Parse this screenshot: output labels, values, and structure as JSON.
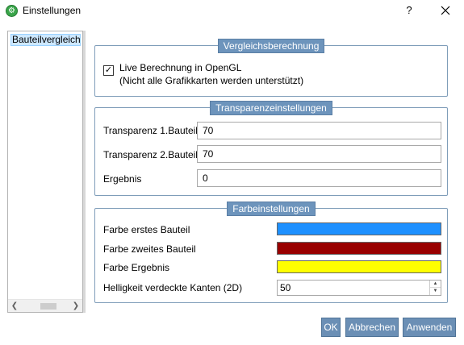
{
  "window": {
    "title": "Einstellungen",
    "help": "?",
    "app_icon": "app-settings-icon"
  },
  "sidebar": {
    "items": [
      {
        "label": "Bauteilvergleich",
        "selected": true
      }
    ]
  },
  "groups": {
    "comparison": {
      "title": "Vergleichsberechnung",
      "live_checkbox_line1": "Live Berechnung in OpenGL",
      "live_checkbox_line2": "(Nicht alle Grafikkarten werden unterstützt)",
      "live_checked": true
    },
    "transparency": {
      "title": "Transparenzeinstellungen",
      "part1_label": "Transparenz 1.Bauteil",
      "part1_value": "70",
      "part2_label": "Transparenz 2.Bauteil",
      "part2_value": "70",
      "result_label": "Ergebnis",
      "result_value": "0"
    },
    "colors": {
      "title": "Farbeinstellungen",
      "first_label": "Farbe erstes Bauteil",
      "first_color": "#1e90ff",
      "second_label": "Farbe zweites Bauteil",
      "second_color": "#990000",
      "result_label": "Farbe Ergebnis",
      "result_color": "#ffff00",
      "brightness_label": "Helligkeit verdeckte Kanten (2D)",
      "brightness_value": "50"
    }
  },
  "buttons": {
    "ok": "OK",
    "cancel": "Abbrechen",
    "apply": "Anwenden"
  }
}
